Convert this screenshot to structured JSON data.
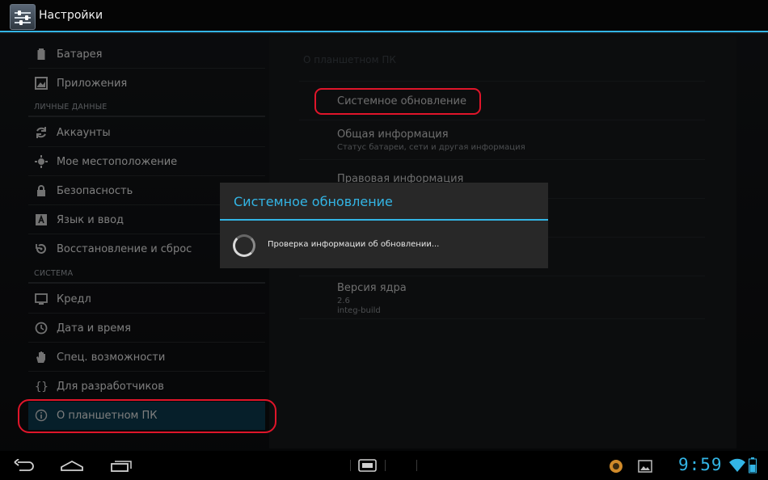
{
  "action_bar": {
    "title": "Настройки",
    "app_icon": "settings-sliders-icon"
  },
  "sidebar": {
    "items_top": [
      {
        "label": "Батарея",
        "icon": "battery-icon"
      },
      {
        "label": "Приложения",
        "icon": "apps-icon"
      }
    ],
    "section_personal": "ЛИЧНЫЕ ДАННЫЕ",
    "items_personal": [
      {
        "label": "Аккаунты",
        "icon": "sync-icon"
      },
      {
        "label": "Мое местоположение",
        "icon": "location-icon"
      },
      {
        "label": "Безопасность",
        "icon": "lock-icon"
      },
      {
        "label": "Язык и ввод",
        "icon": "keyboard-letter-icon"
      },
      {
        "label": "Восстановление и сброс",
        "icon": "restore-icon"
      }
    ],
    "section_system": "СИСТЕМА",
    "items_system": [
      {
        "label": "Кредл",
        "icon": "monitor-icon"
      },
      {
        "label": "Дата и время",
        "icon": "clock-icon"
      },
      {
        "label": "Спец. возможности",
        "icon": "hand-icon"
      },
      {
        "label": "Для разработчиков",
        "icon": "braces-icon"
      },
      {
        "label": "О планшетном ПК",
        "icon": "info-icon",
        "selected": true
      }
    ]
  },
  "content": {
    "breadcrumb": "О планшетном ПК",
    "rows": [
      {
        "title": "Системное обновление"
      },
      {
        "title": "Общая информация",
        "subtitle": "Статус батареи, сети и другая информация"
      },
      {
        "title": "Правовая информация"
      },
      {
        "title": "Версия ядра",
        "subtitle": "2.6",
        "subtitle2": "integ-build"
      }
    ]
  },
  "dialog": {
    "title": "Системное обновление",
    "message": "Проверка информации об обновлении..."
  },
  "status_bar": {
    "time": "9:59"
  },
  "colors": {
    "accent": "#33b5e5",
    "highlight_mark": "#e0152a",
    "selected_bg": "#0b3a4d"
  }
}
